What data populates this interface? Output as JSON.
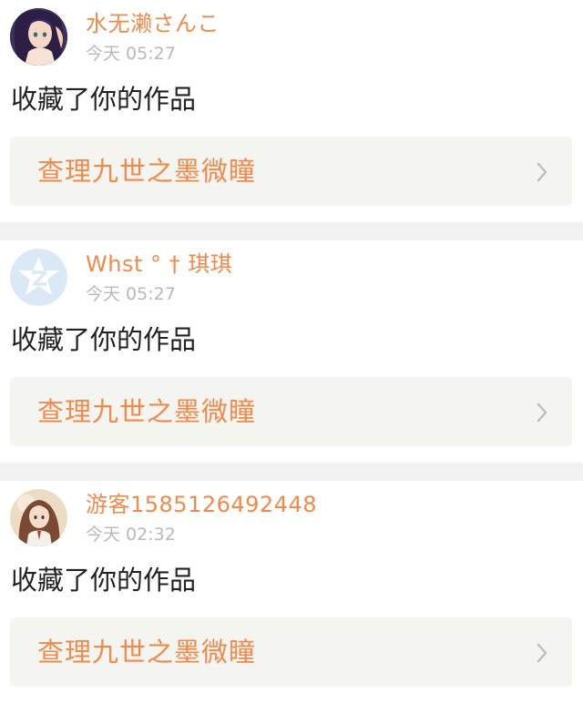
{
  "notifications": [
    {
      "username": "水无濑さんこ",
      "time": "今天 05:27",
      "action": "收藏了你的作品",
      "work_title": "查理九世之墨微瞳",
      "avatar_icon": "anime-girl-avatar",
      "chevron_icon": "chevron-right-icon"
    },
    {
      "username": "Whst ° † 琪琪",
      "time": "今天 05:27",
      "action": "收藏了你的作品",
      "work_title": "查理九世之墨微瞳",
      "avatar_icon": "default-qzone-avatar",
      "chevron_icon": "chevron-right-icon"
    },
    {
      "username": "游客1585126492448",
      "time": "今天 02:32",
      "action": "收藏了你的作品",
      "work_title": "查理九世之墨微瞳",
      "avatar_icon": "anime-girl-avatar",
      "chevron_icon": "chevron-right-icon"
    }
  ],
  "colors": {
    "accent": "#f08a4b",
    "timestamp": "#b9b9b9",
    "link_background": "#f4f4f1",
    "divider": "#f2f2f2"
  }
}
